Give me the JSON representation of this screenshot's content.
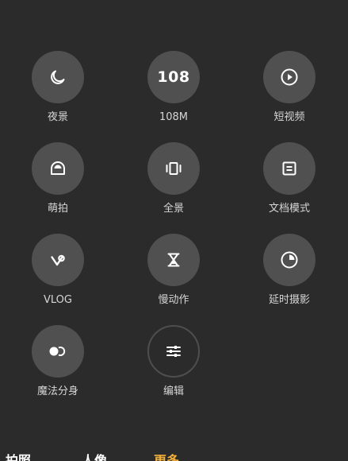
{
  "modes": [
    [
      {
        "label": "夜景",
        "icon": "night-icon"
      },
      {
        "label": "108M",
        "icon_text": "108"
      },
      {
        "label": "短视频",
        "icon": "short-video-icon"
      }
    ],
    [
      {
        "label": "萌拍",
        "icon": "cute-shot-icon"
      },
      {
        "label": "全景",
        "icon": "panorama-icon"
      },
      {
        "label": "文档模式",
        "icon": "document-icon"
      }
    ],
    [
      {
        "label": "VLOG",
        "icon": "vlog-icon"
      },
      {
        "label": "慢动作",
        "icon": "slow-motion-icon"
      },
      {
        "label": "延时摄影",
        "icon": "timelapse-icon"
      }
    ],
    [
      {
        "label": "魔法分身",
        "icon": "clone-icon"
      },
      {
        "label": "编辑",
        "icon": "edit-sliders-icon"
      }
    ]
  ],
  "tabs": [
    {
      "label": "拍照",
      "active": false
    },
    {
      "label": "人像",
      "active": false
    },
    {
      "label": "更多",
      "active": true
    }
  ],
  "colors": {
    "background": "#2b2b2b",
    "circle": "#505050",
    "active_tab": "#f2b13a"
  }
}
